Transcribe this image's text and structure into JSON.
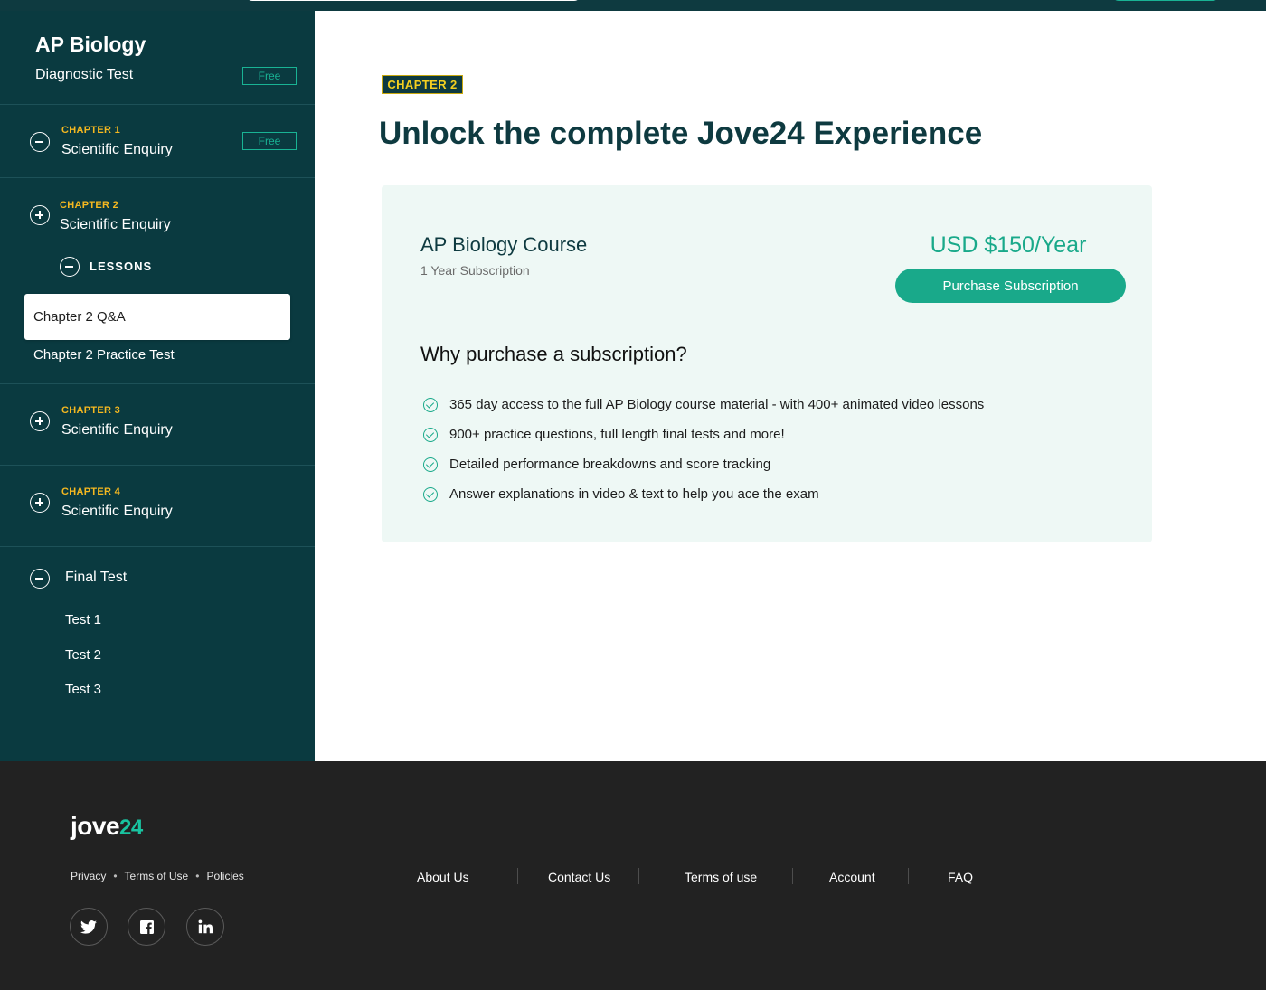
{
  "sidebar": {
    "course_title": "AP Biology",
    "diagnostic": {
      "label": "Diagnostic Test",
      "badge": "Free"
    },
    "chapter1": {
      "label": "CHAPTER 1",
      "title": "Scientific Enquiry",
      "badge": "Free"
    },
    "chapter2": {
      "label": "CHAPTER 2",
      "title": "Scientific Enquiry",
      "lessons_label": "LESSONS",
      "lessons": [
        "Chapter 2 Q&A",
        "Chapter 2 Practice Test"
      ]
    },
    "chapter3": {
      "label": "CHAPTER 3",
      "title": "Scientific Enquiry"
    },
    "chapter4": {
      "label": "CHAPTER 4",
      "title": "Scientific Enquiry"
    },
    "final": {
      "title": "Final Test",
      "tests": [
        "Test 1",
        "Test 2",
        "Test 3"
      ]
    }
  },
  "main": {
    "chapter_badge": "CHAPTER 2",
    "title": "Unlock the complete Jove24 Experience",
    "card": {
      "course_name": "AP Biology Course",
      "subscription": "1 Year Subscription",
      "price": "USD $150/Year",
      "purchase_label": "Purchase Subscription",
      "why_title": "Why purchase a subscription?",
      "benefits": [
        "365 day access to the full AP Biology course material - with 400+ animated video lessons",
        "900+ practice questions, full length final tests and more!",
        "Detailed performance breakdowns and score tracking",
        "Answer explanations in video & text to help you ace the exam"
      ]
    }
  },
  "footer": {
    "logo_main": "jove",
    "logo_num": "24",
    "legal": [
      "Privacy",
      "Terms of Use",
      "Policies"
    ],
    "nav": [
      "About Us",
      "Contact Us",
      "Terms of use",
      "Account",
      "FAQ"
    ],
    "social_icons": [
      "twitter-icon",
      "facebook-icon",
      "linkedin-icon"
    ]
  },
  "colors": {
    "sidebar_bg": "#0a3a40",
    "accent": "#19a98a",
    "chapter_label": "#f5b820",
    "footer_bg": "#222222"
  }
}
